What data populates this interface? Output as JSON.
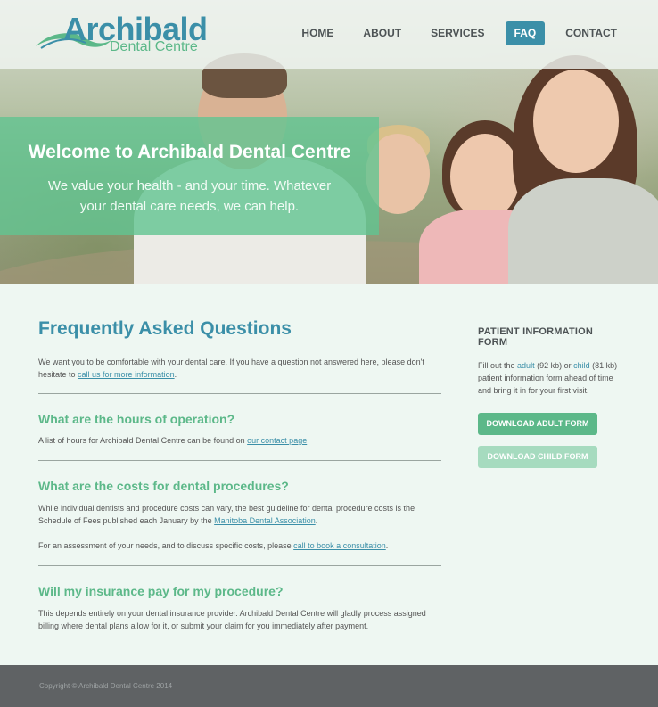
{
  "brand": {
    "name": "Archibald",
    "sub": "Dental Centre",
    "colors": {
      "teal": "#3b8fa8",
      "green": "#5cb889",
      "footer": "#5f6264"
    }
  },
  "nav": {
    "items": [
      {
        "label": "HOME"
      },
      {
        "label": "ABOUT"
      },
      {
        "label": "SERVICES"
      },
      {
        "label": "FAQ",
        "active": true
      },
      {
        "label": "CONTACT"
      }
    ]
  },
  "hero": {
    "title": "Welcome to Archibald Dental Centre",
    "tagline": "We value your health - and your time. Whatever your dental care needs, we can help."
  },
  "main": {
    "title": "Frequently Asked Questions",
    "intro_text": "We want you to be comfortable with your dental care. If you have a question not answered here, please don't hesitate to",
    "intro_link": "call us for more information",
    "faqs": [
      {
        "question": "What are the hours of operation?",
        "answer_pre": "A list of hours for Archibald Dental Centre can be found on",
        "answer_link": "our contact page"
      },
      {
        "question": "What are the costs for dental procedures?",
        "answer_pre": "While individual dentists and procedure costs can vary, the best guideline for dental procedure costs is the Schedule of Fees published each January by the",
        "answer_link": "Manitoba Dental Association",
        "answer2_pre": "For an assessment of your needs, and to discuss specific costs, please",
        "answer2_link": "call to book a consultation"
      },
      {
        "question": "Will my insurance pay for my procedure?",
        "answer": "This depends entirely on your dental insurance provider. Archibald Dental Centre will gladly process assigned billing where dental plans allow for it, or submit your claim for you immediately after payment."
      }
    ]
  },
  "sidebar": {
    "title": "PATIENT INFORMATION FORM",
    "desc_pre": "Fill out the",
    "adult_link": "adult",
    "adult_size": "(92 kb) or",
    "child_link": "child",
    "child_size": "(81 kb)",
    "desc_post": "patient information form ahead of time and bring it in for your first visit.",
    "adult_button": "DOWNLOAD ADULT FORM",
    "child_button": "DOWNLOAD CHILD FORM"
  },
  "footer": {
    "copyright": "Copyright © Archibald Dental Centre 2014"
  }
}
